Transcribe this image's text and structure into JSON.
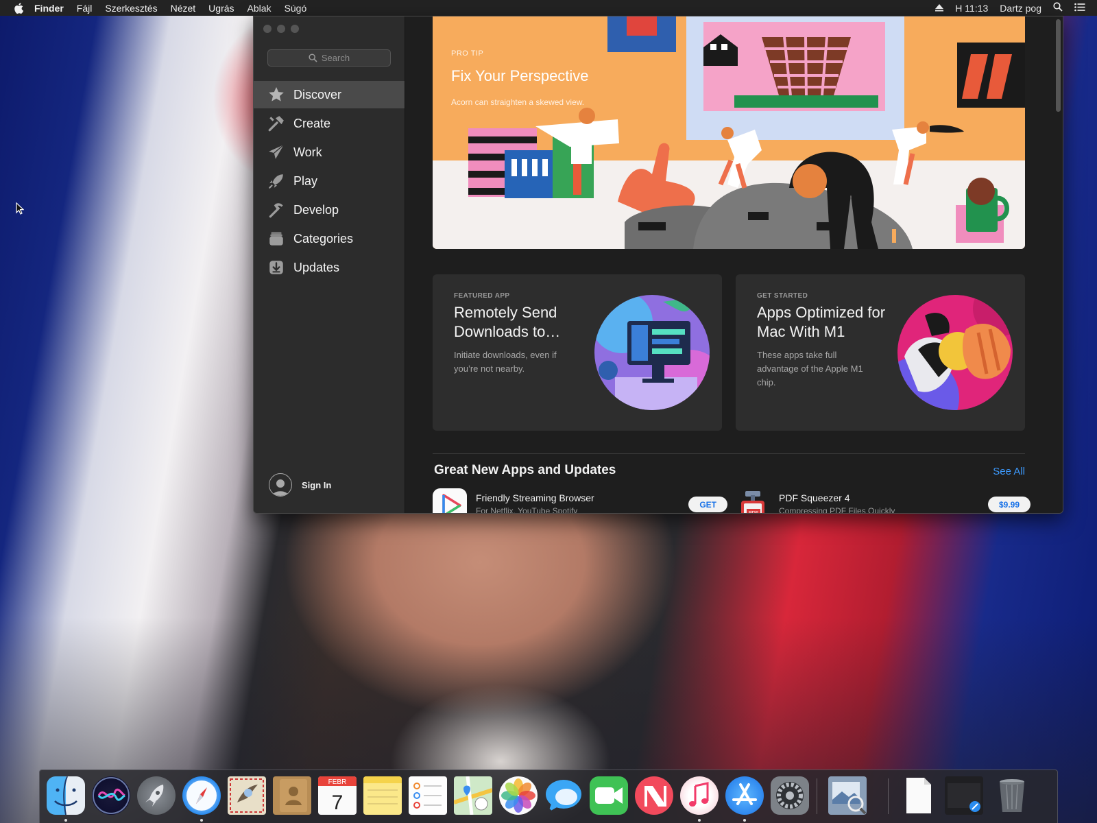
{
  "menubar": {
    "app": "Finder",
    "items": [
      "Fájl",
      "Szerkesztés",
      "Nézet",
      "Ugrás",
      "Ablak",
      "Súgó"
    ],
    "clock": "H 11:13",
    "user": "Dartz pog"
  },
  "sidebar": {
    "search_placeholder": "Search",
    "items": [
      {
        "label": "Discover",
        "icon": "star-icon",
        "active": true
      },
      {
        "label": "Create",
        "icon": "hammer-brush-icon"
      },
      {
        "label": "Work",
        "icon": "paper-plane-icon"
      },
      {
        "label": "Play",
        "icon": "rocket-icon"
      },
      {
        "label": "Develop",
        "icon": "hammer-icon"
      },
      {
        "label": "Categories",
        "icon": "stack-icon"
      },
      {
        "label": "Updates",
        "icon": "download-icon"
      }
    ],
    "signin": "Sign In"
  },
  "hero": {
    "eyebrow": "PRO TIP",
    "title": "Fix Your Perspective",
    "subtitle": "Acorn can straighten a skewed view."
  },
  "cards": [
    {
      "eyebrow": "FEATURED APP",
      "title": "Remotely Send Downloads to…",
      "desc": "Initiate downloads, even if you’re not nearby."
    },
    {
      "eyebrow": "GET STARTED",
      "title": "Apps Optimized for Mac With M1",
      "desc": "These apps take full advantage of the Apple M1 chip."
    }
  ],
  "section": {
    "title": "Great New Apps and Updates",
    "see_all": "See All"
  },
  "apps": [
    {
      "name": "Friendly Streaming Browser",
      "subtitle": "For Netflix, YouTube Spotify",
      "button": "GET"
    },
    {
      "name": "PDF Squeezer 4",
      "subtitle": "Compressing PDF Files Quickly",
      "button": "$9.99"
    }
  ],
  "dock": {
    "calendar_month": "FEBR",
    "calendar_day": "7",
    "icons": [
      "finder-icon",
      "siri-icon",
      "launchpad-icon",
      "safari-icon",
      "mail-icon",
      "contacts-icon",
      "calendar-icon",
      "notes-icon",
      "reminders-icon",
      "maps-icon",
      "photos-icon",
      "messages-icon",
      "facetime-icon",
      "news-icon",
      "music-icon",
      "app-store-icon",
      "system-preferences-icon",
      "preview-icon",
      "document-icon",
      "downloads-stack-icon",
      "trash-icon"
    ]
  },
  "colors": {
    "accent": "#3d9bff",
    "menubar": "#232323",
    "sidebar": "#2c2c2c",
    "content": "#1e1e1e",
    "hero": "#f7ab5c"
  }
}
